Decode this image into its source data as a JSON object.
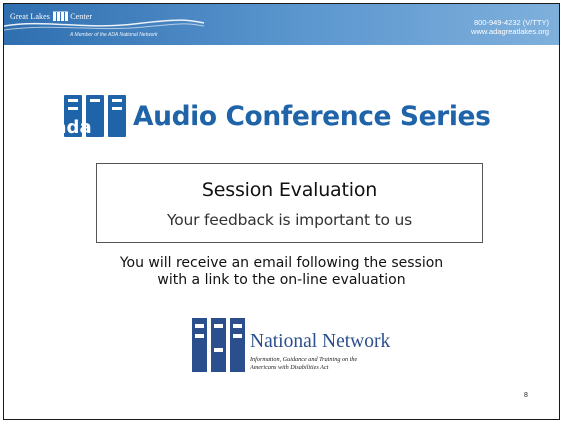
{
  "header": {
    "org_name": "Great Lakes",
    "org_name_suffix": "Center",
    "member_line": "A Member of the ADA National Network",
    "phone": "800-949-4232  (V/TTY)",
    "website": "www.adagreatlakes.org"
  },
  "title": {
    "logo_text": "ada",
    "text": "Audio Conference Series"
  },
  "evaluation_box": {
    "title": "Session Evaluation",
    "subtitle": "Your feedback is important to us"
  },
  "note": {
    "line1": "You will receive an email following the session",
    "line2": "with a link to the on-line evaluation"
  },
  "network_logo": {
    "title": "National Network",
    "subtitle_line1": "Information, Guidance and Training on the",
    "subtitle_line2": "Americans with Disabilities Act"
  },
  "page_number": "8",
  "colors": {
    "brand_blue": "#1f63a8",
    "logo_blue": "#2b4f8c",
    "header_start": "#2f6fb0",
    "header_end": "#7fb0dc"
  }
}
